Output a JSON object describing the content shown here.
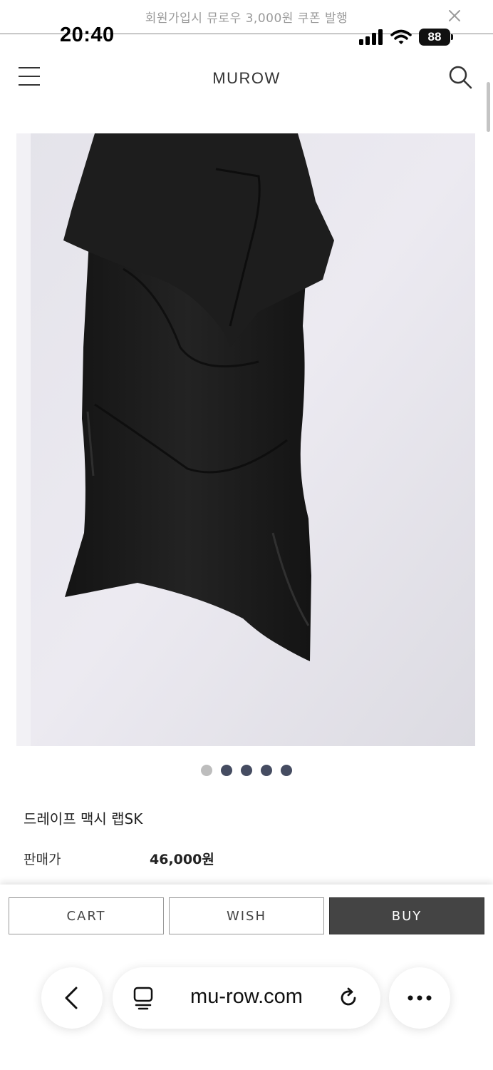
{
  "banner": {
    "text": "회원가입시 뮤로우 3,000원 쿠폰 발행"
  },
  "status_bar": {
    "time": "20:40",
    "battery": "88"
  },
  "header": {
    "logo": "MUROW"
  },
  "product": {
    "name": "드레이프 맥시 랩SK",
    "price_label": "판매가",
    "price": "46,000원",
    "image_count": 5,
    "active_image": 1
  },
  "actions": {
    "cart": "CART",
    "wish": "WISH",
    "buy": "BUY"
  },
  "browser": {
    "url": "mu-row.com"
  },
  "colors": {
    "buy_button": "#444444",
    "carousel_dot": "#454c61",
    "carousel_dot_active": "#bdbdbd"
  }
}
